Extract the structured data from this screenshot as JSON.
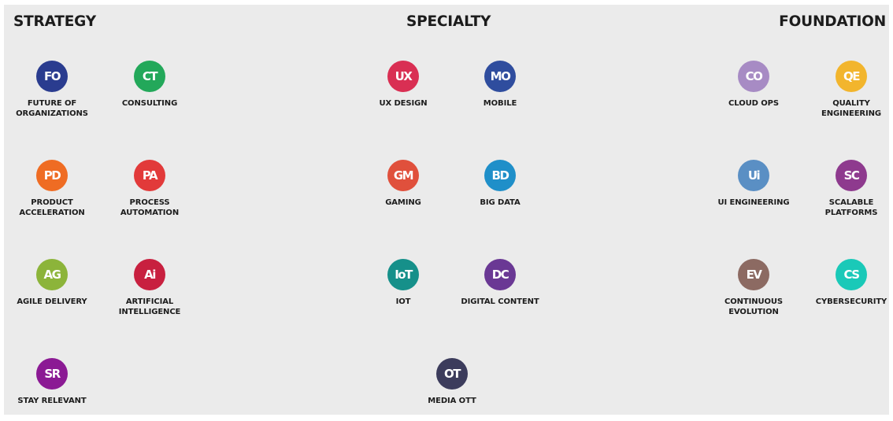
{
  "columns": {
    "strategy": "STRATEGY",
    "specialty": "SPECIALTY",
    "foundation": "FOUNDATION"
  },
  "items": [
    {
      "abbr": "FO",
      "line1": "FUTURE OF",
      "line2": "ORGANIZATIONS",
      "color": "#2a3c8f"
    },
    {
      "abbr": "CT",
      "line1": "CONSULTING",
      "line2": "",
      "color": "#23a85a"
    },
    {
      "abbr": "PD",
      "line1": "PRODUCT",
      "line2": "ACCELERATION",
      "color": "#ef6c23"
    },
    {
      "abbr": "PA",
      "line1": "PROCESS",
      "line2": "AUTOMATION",
      "color": "#e23a3a"
    },
    {
      "abbr": "AG",
      "line1": "AGILE DELIVERY",
      "line2": "",
      "color": "#8cb43a"
    },
    {
      "abbr": "Ai",
      "line1": "ARTIFICIAL",
      "line2": "INTELLIGENCE",
      "color": "#c8203f"
    },
    {
      "abbr": "SR",
      "line1": "STAY RELEVANT",
      "line2": "",
      "color": "#8b1a94"
    },
    {
      "abbr": "UX",
      "line1": "UX DESIGN",
      "line2": "",
      "color": "#d92f53"
    },
    {
      "abbr": "MO",
      "line1": "MOBILE",
      "line2": "",
      "color": "#2f4d9e"
    },
    {
      "abbr": "GM",
      "line1": "GAMING",
      "line2": "",
      "color": "#e0503c"
    },
    {
      "abbr": "BD",
      "line1": "BIG DATA",
      "line2": "",
      "color": "#1f8fc9"
    },
    {
      "abbr": "IoT",
      "line1": "IOT",
      "line2": "",
      "color": "#16908a"
    },
    {
      "abbr": "DC",
      "line1": "DIGITAL CONTENT",
      "line2": "",
      "color": "#6a3894"
    },
    {
      "abbr": "OT",
      "line1": "MEDIA OTT",
      "line2": "",
      "color": "#3c3c5c"
    },
    {
      "abbr": "CO",
      "line1": "CLOUD OPS",
      "line2": "",
      "color": "#a78bc4"
    },
    {
      "abbr": "QE",
      "line1": "QUALITY",
      "line2": "ENGINEERING",
      "color": "#f2b52d"
    },
    {
      "abbr": "Ui",
      "line1": "UI ENGINEERING",
      "line2": "",
      "color": "#5a8fc4"
    },
    {
      "abbr": "SC",
      "line1": "SCALABLE",
      "line2": "PLATFORMS",
      "color": "#8e3a8e"
    },
    {
      "abbr": "EV",
      "line1": "CONTINUOUS",
      "line2": "EVOLUTION",
      "color": "#8c6a62"
    },
    {
      "abbr": "CS",
      "line1": "CYBERSECURITY",
      "line2": "",
      "color": "#1ac9b8"
    }
  ]
}
